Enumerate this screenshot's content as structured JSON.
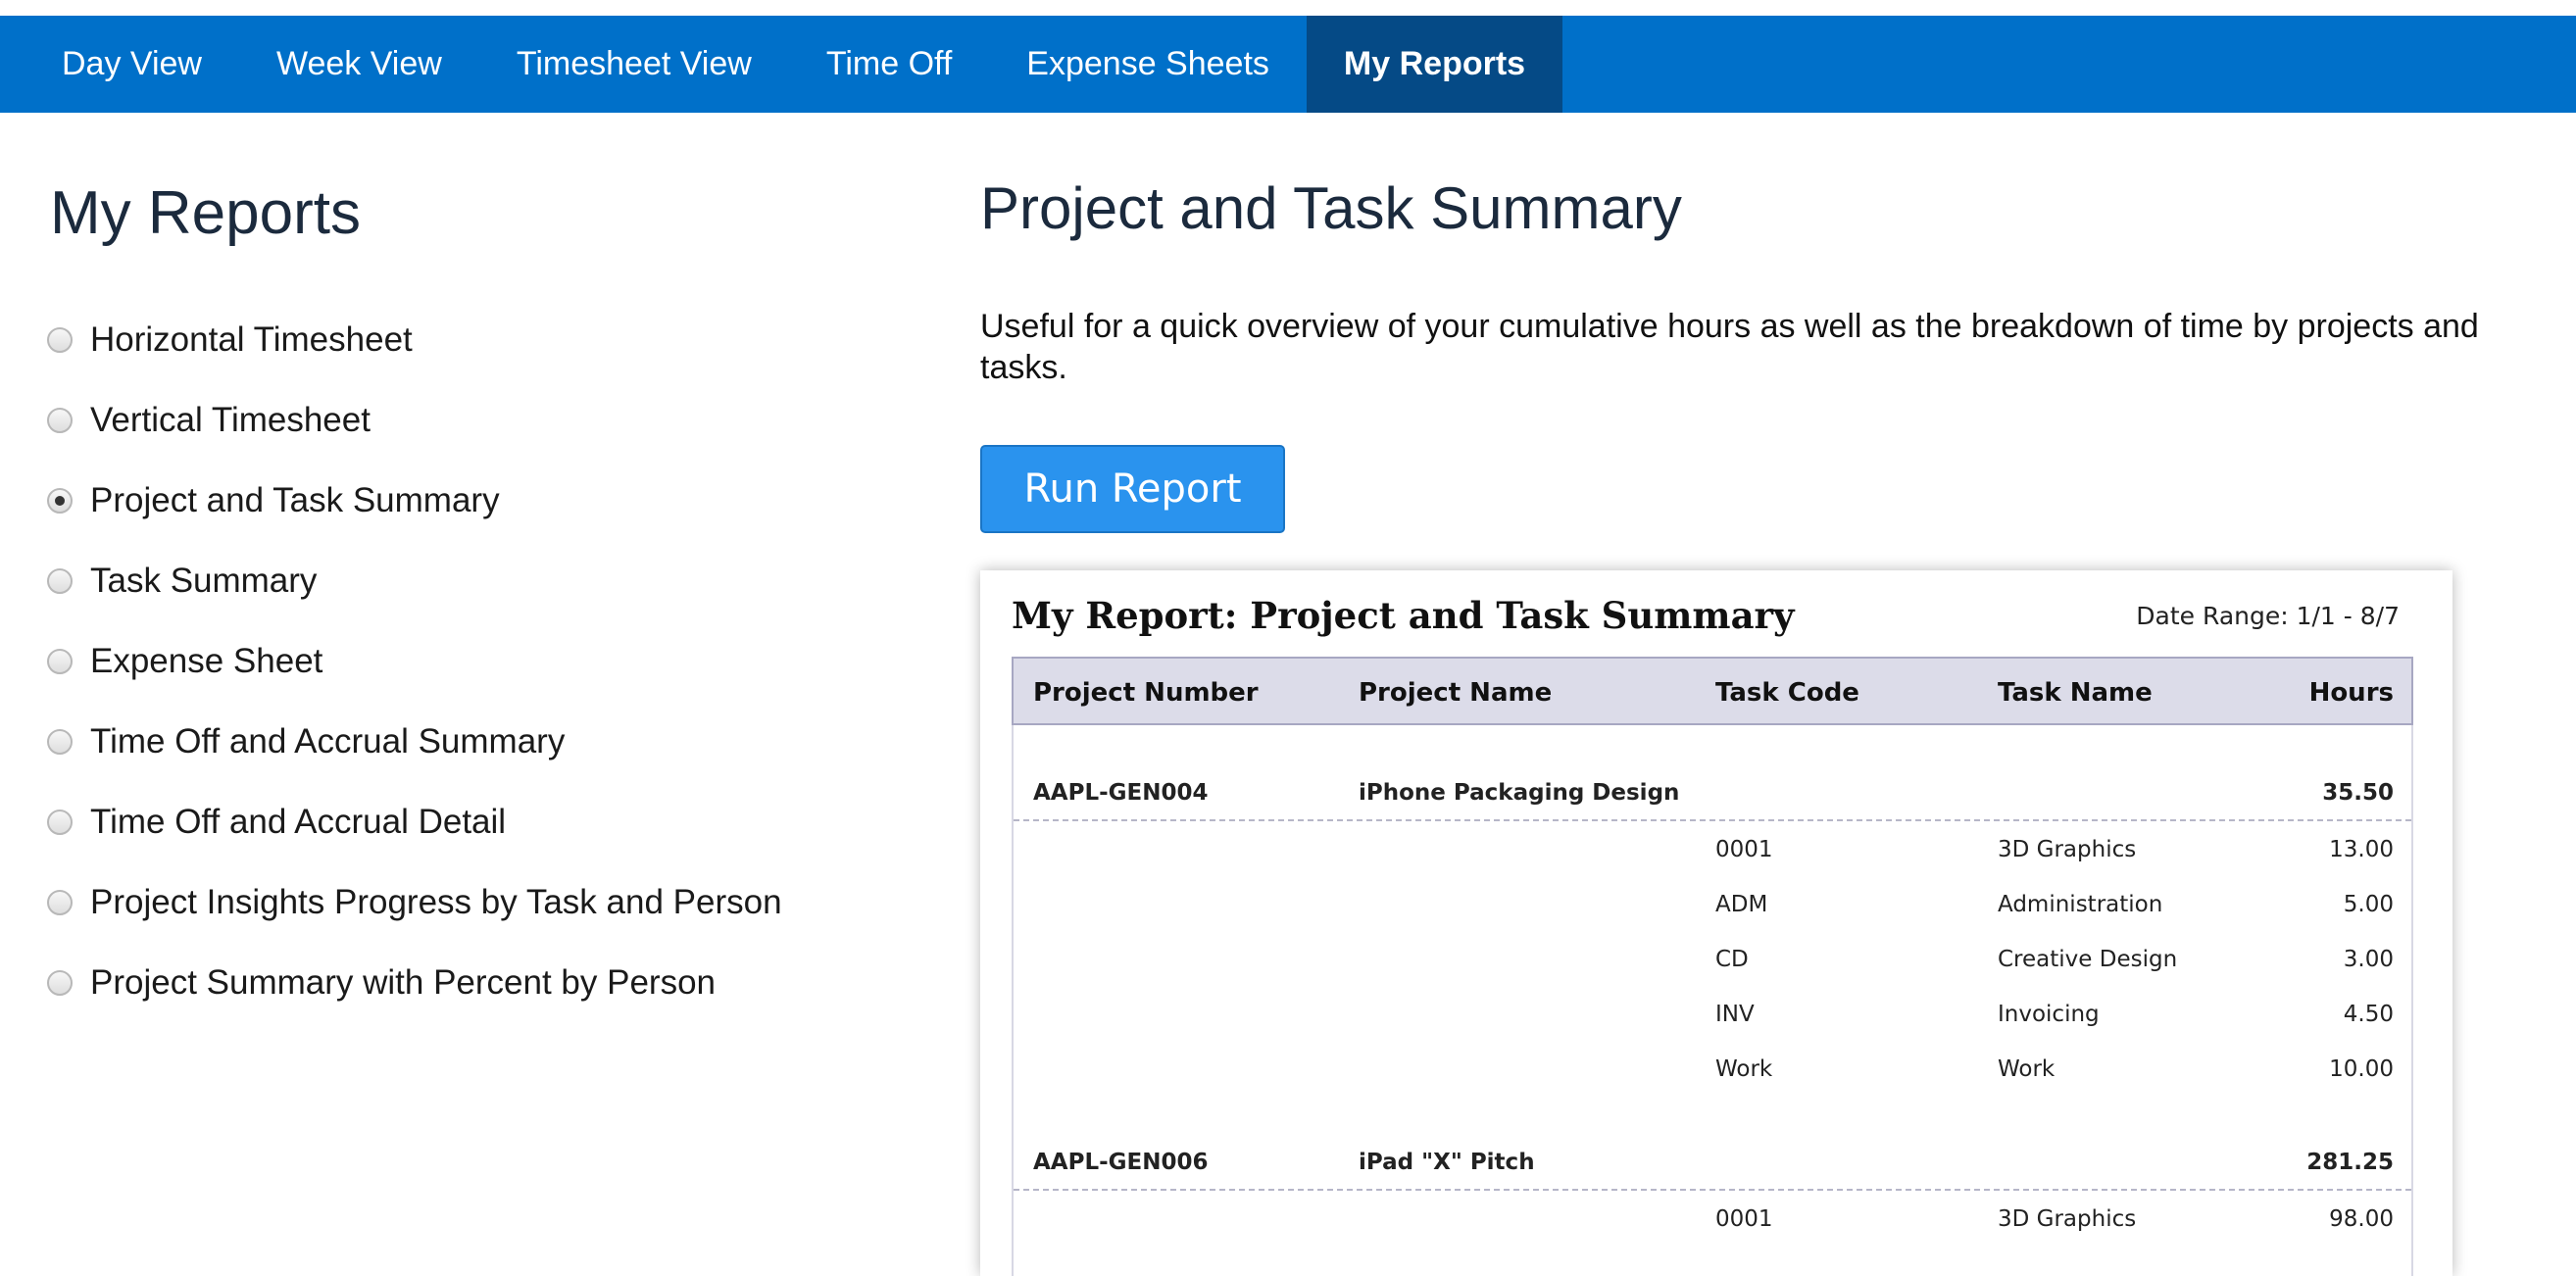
{
  "nav": {
    "tabs": [
      {
        "label": "Day View"
      },
      {
        "label": "Week View"
      },
      {
        "label": "Timesheet View"
      },
      {
        "label": "Time Off"
      },
      {
        "label": "Expense Sheets"
      },
      {
        "label": "My Reports",
        "active": true
      }
    ]
  },
  "sidebar": {
    "title": "My Reports",
    "reports": [
      {
        "label": "Horizontal Timesheet",
        "checked": false
      },
      {
        "label": "Vertical Timesheet",
        "checked": false
      },
      {
        "label": "Project and Task Summary",
        "checked": true
      },
      {
        "label": "Task Summary",
        "checked": false
      },
      {
        "label": "Expense Sheet",
        "checked": false
      },
      {
        "label": "Time Off and Accrual Summary",
        "checked": false
      },
      {
        "label": "Time Off and Accrual Detail",
        "checked": false
      },
      {
        "label": "Project Insights Progress by Task and Person",
        "checked": false
      },
      {
        "label": "Project Summary with Percent by Person",
        "checked": false
      }
    ]
  },
  "main": {
    "title": "Project and Task Summary",
    "description": "Useful for a quick overview of your cumulative hours as well as the breakdown of time by projects and tasks.",
    "run_button": "Run Report",
    "preview": {
      "title": "My Report: Project and Task Summary",
      "date_range": "Date Range: 1/1 - 8/7",
      "columns": {
        "project_number": "Project Number",
        "project_name": "Project Name",
        "task_code": "Task Code",
        "task_name": "Task Name",
        "hours": "Hours"
      },
      "projects": [
        {
          "number": "AAPL-GEN004",
          "name": "iPhone Packaging Design",
          "hours": "35.50",
          "tasks": [
            {
              "code": "0001",
              "name": "3D Graphics",
              "hours": "13.00"
            },
            {
              "code": "ADM",
              "name": "Administration",
              "hours": "5.00"
            },
            {
              "code": "CD",
              "name": "Creative Design",
              "hours": "3.00"
            },
            {
              "code": "INV",
              "name": "Invoicing",
              "hours": "4.50"
            },
            {
              "code": "Work",
              "name": "Work",
              "hours": "10.00"
            }
          ]
        },
        {
          "number": "AAPL-GEN006",
          "name": "iPad \"X\" Pitch",
          "hours": "281.25",
          "tasks": [
            {
              "code": "0001",
              "name": "3D Graphics",
              "hours": "98.00"
            }
          ]
        }
      ]
    }
  }
}
